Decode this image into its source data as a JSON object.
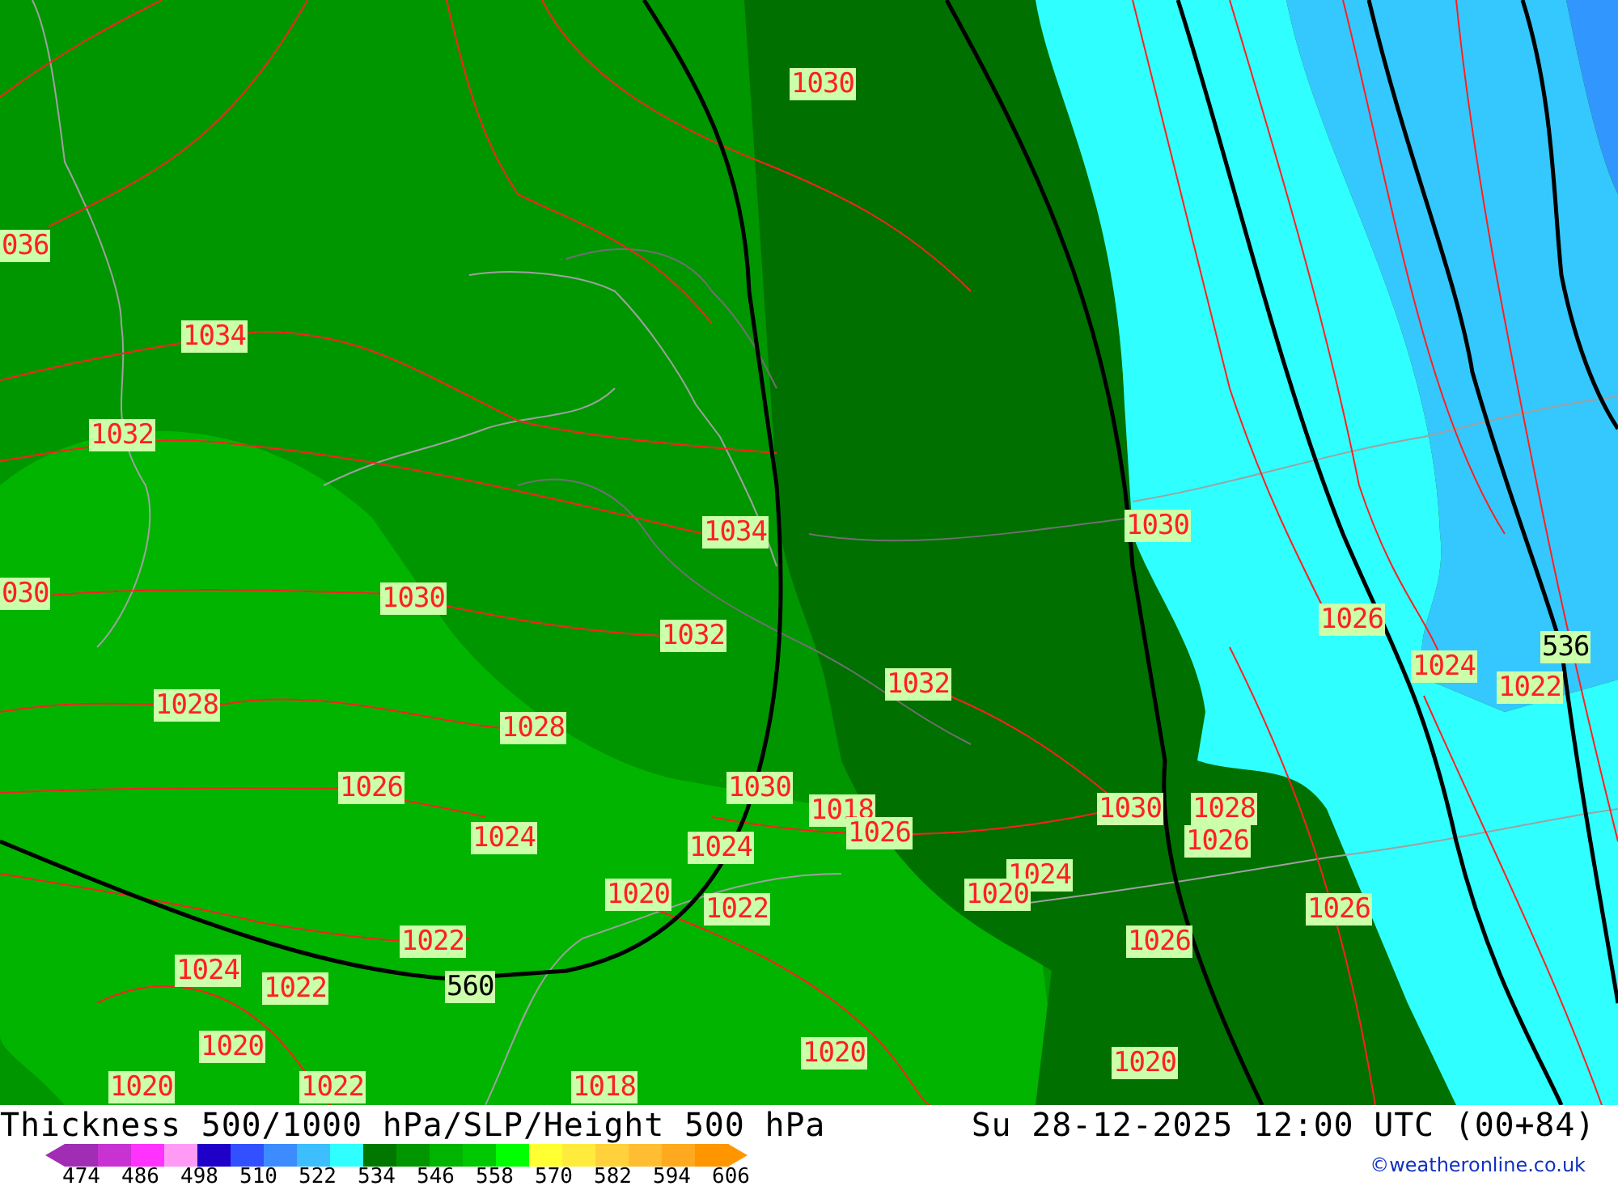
{
  "map": {
    "labels": [
      {
        "kind": "pressure",
        "text": "1030"
      },
      {
        "kind": "pressure",
        "text": "036"
      },
      {
        "kind": "pressure",
        "text": "1034"
      },
      {
        "kind": "pressure",
        "text": "1032"
      },
      {
        "kind": "pressure",
        "text": "1034"
      },
      {
        "kind": "pressure",
        "text": "1030"
      },
      {
        "kind": "pressure",
        "text": "030"
      },
      {
        "kind": "pressure",
        "text": "1030"
      },
      {
        "kind": "pressure",
        "text": "1032"
      },
      {
        "kind": "pressure",
        "text": "1032"
      },
      {
        "kind": "pressure",
        "text": "1026"
      },
      {
        "kind": "pressure",
        "text": "1024"
      },
      {
        "kind": "pressure",
        "text": "1022"
      },
      {
        "kind": "thickness",
        "text": "536"
      },
      {
        "kind": "pressure",
        "text": "1028"
      },
      {
        "kind": "pressure",
        "text": "1028"
      },
      {
        "kind": "pressure",
        "text": "1026"
      },
      {
        "kind": "pressure",
        "text": "1030"
      },
      {
        "kind": "pressure",
        "text": "1018"
      },
      {
        "kind": "pressure",
        "text": "1030"
      },
      {
        "kind": "pressure",
        "text": "1028"
      },
      {
        "kind": "pressure",
        "text": "1024"
      },
      {
        "kind": "pressure",
        "text": "1024"
      },
      {
        "kind": "pressure",
        "text": "1026"
      },
      {
        "kind": "pressure",
        "text": "1026"
      },
      {
        "kind": "pressure",
        "text": "1024"
      },
      {
        "kind": "pressure",
        "text": "1020"
      },
      {
        "kind": "pressure",
        "text": "1022"
      },
      {
        "kind": "pressure",
        "text": "1020"
      },
      {
        "kind": "pressure",
        "text": "1026"
      },
      {
        "kind": "pressure",
        "text": "1022"
      },
      {
        "kind": "pressure",
        "text": "1026"
      },
      {
        "kind": "pressure",
        "text": "1024"
      },
      {
        "kind": "pressure",
        "text": "1022"
      },
      {
        "kind": "thickness",
        "text": "560"
      },
      {
        "kind": "pressure",
        "text": "1020"
      },
      {
        "kind": "pressure",
        "text": "1020"
      },
      {
        "kind": "pressure",
        "text": "1020"
      },
      {
        "kind": "pressure",
        "text": "1020"
      },
      {
        "kind": "pressure",
        "text": "1022"
      },
      {
        "kind": "pressure",
        "text": "1018"
      }
    ]
  },
  "footer": {
    "title": "Thickness 500/1000 hPa/SLP/Height 500 hPa",
    "valid_time": "Su 28-12-2025 12:00 UTC (00+84)",
    "credit": "©weatheronline.co.uk",
    "legend": {
      "colors": [
        {
          "color": "#a02db4"
        },
        {
          "color": "#c832d2"
        },
        {
          "color": "#ff32ff"
        },
        {
          "color": "#ff9bf5"
        },
        {
          "color": "#1e00c8"
        },
        {
          "color": "#3250ff"
        },
        {
          "color": "#3c8cff"
        },
        {
          "color": "#3cbeff"
        },
        {
          "color": "#30ffff"
        },
        {
          "color": "#007800"
        },
        {
          "color": "#009600"
        },
        {
          "color": "#00b400"
        },
        {
          "color": "#00c800"
        },
        {
          "color": "#00ff00"
        },
        {
          "color": "#ffff32"
        },
        {
          "color": "#ffeb3c"
        },
        {
          "color": "#ffd23c"
        },
        {
          "color": "#ffbe32"
        },
        {
          "color": "#ffaa1e"
        },
        {
          "color": "#ff9600"
        }
      ],
      "ticks": [
        "474",
        "486",
        "498",
        "510",
        "522",
        "534",
        "546",
        "558",
        "570",
        "582",
        "594",
        "606"
      ]
    }
  }
}
